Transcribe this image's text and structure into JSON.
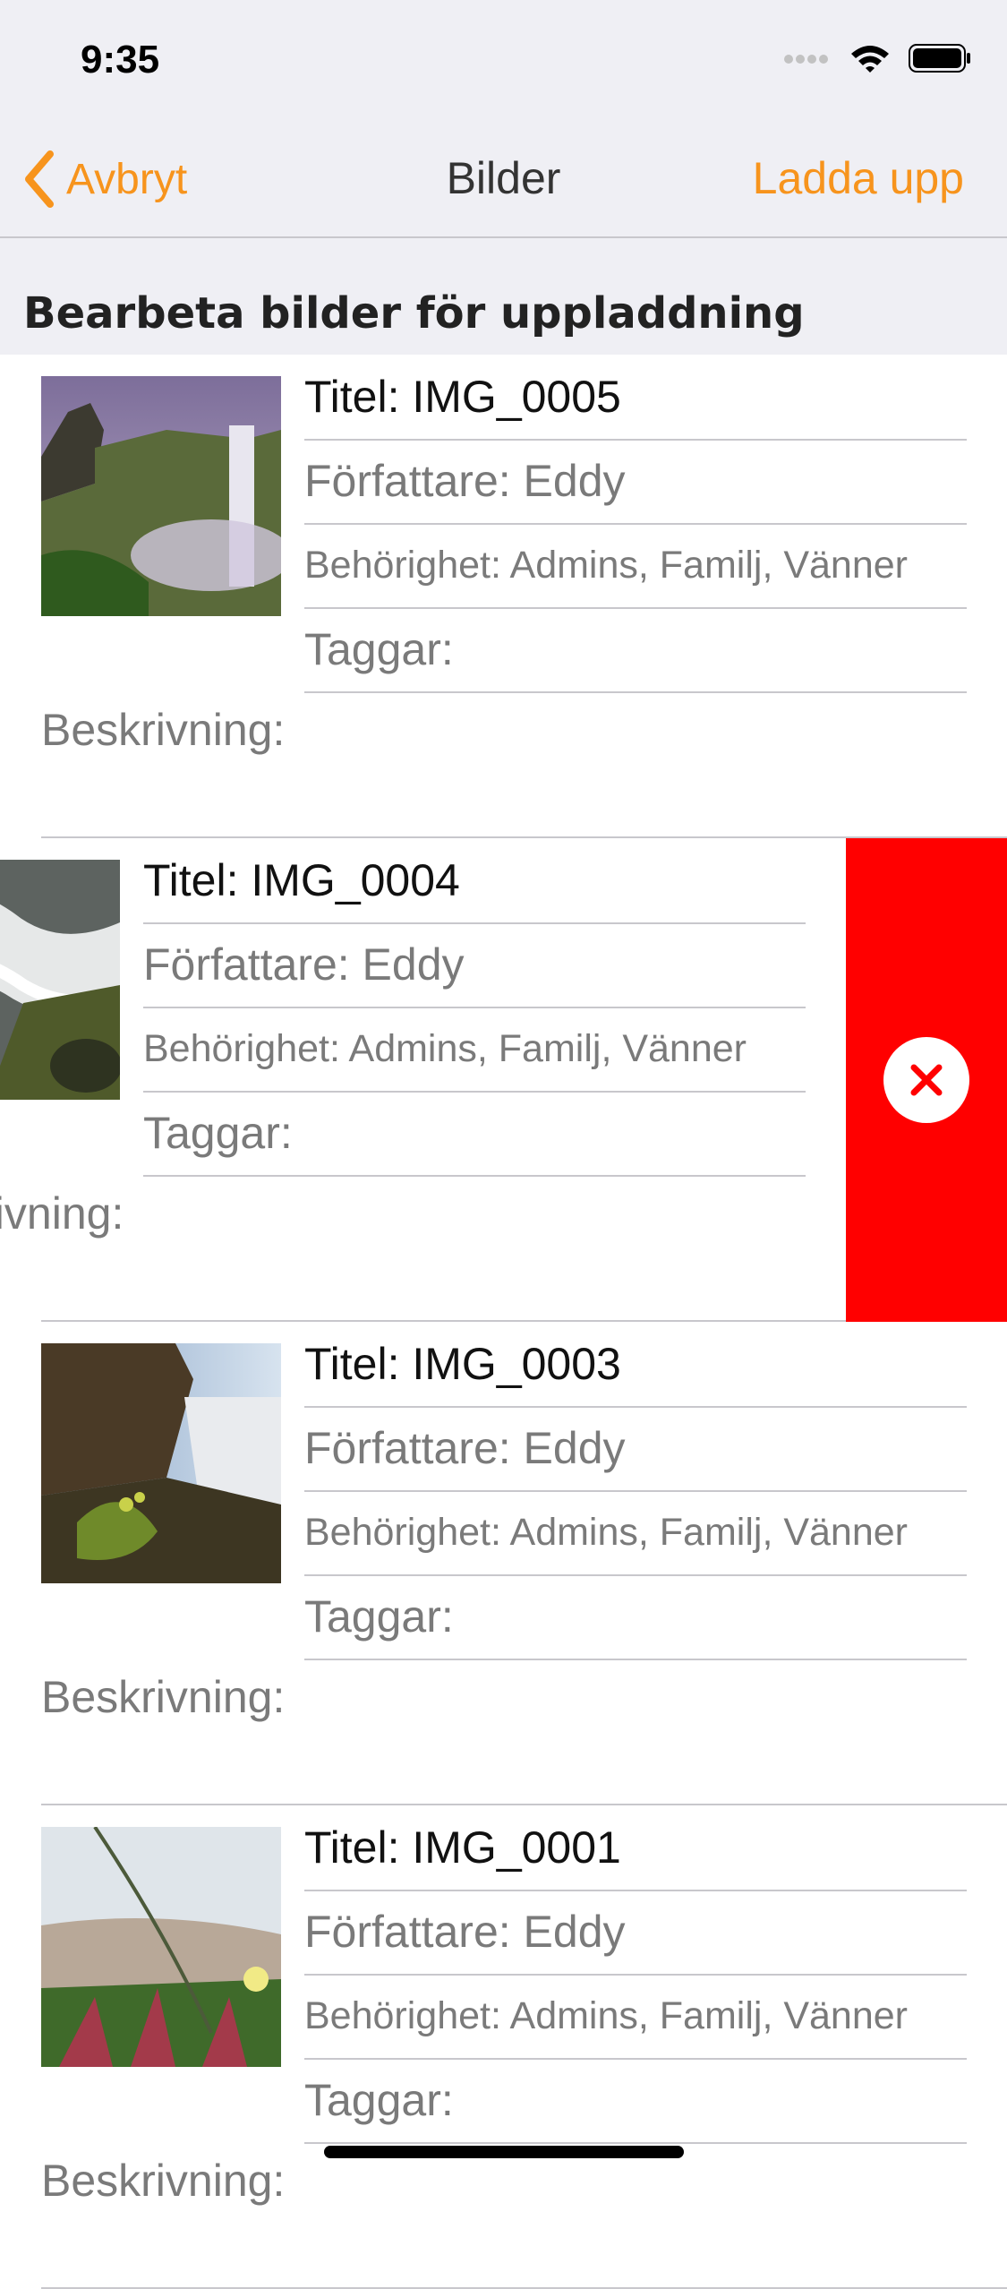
{
  "status_bar": {
    "time": "9:35"
  },
  "nav": {
    "back_label": "Avbryt",
    "title": "Bilder",
    "action_label": "Ladda upp"
  },
  "section": {
    "title": "Bearbeta bilder för uppladdning"
  },
  "items": [
    {
      "title": "Titel: IMG_0005",
      "author": "Författare: Eddy",
      "permission": "Behörighet: Admins, Familj, Vänner",
      "tags": "Taggar:",
      "description": "Beskrivning:"
    },
    {
      "title": "Titel: IMG_0004",
      "author": "Författare: Eddy",
      "permission": "Behörighet: Admins, Familj, Vänner",
      "tags": "Taggar:",
      "description": "Beskrivning:"
    },
    {
      "title": "Titel: IMG_0003",
      "author": "Författare: Eddy",
      "permission": "Behörighet: Admins, Familj, Vänner",
      "tags": "Taggar:",
      "description": "Beskrivning:"
    },
    {
      "title": "Titel: IMG_0001",
      "author": "Författare: Eddy",
      "permission": "Behörighet: Admins, Familj, Vänner",
      "tags": "Taggar:",
      "description": "Beskrivning:"
    }
  ],
  "colors": {
    "accent": "#f7941d",
    "delete": "#ff0000"
  }
}
